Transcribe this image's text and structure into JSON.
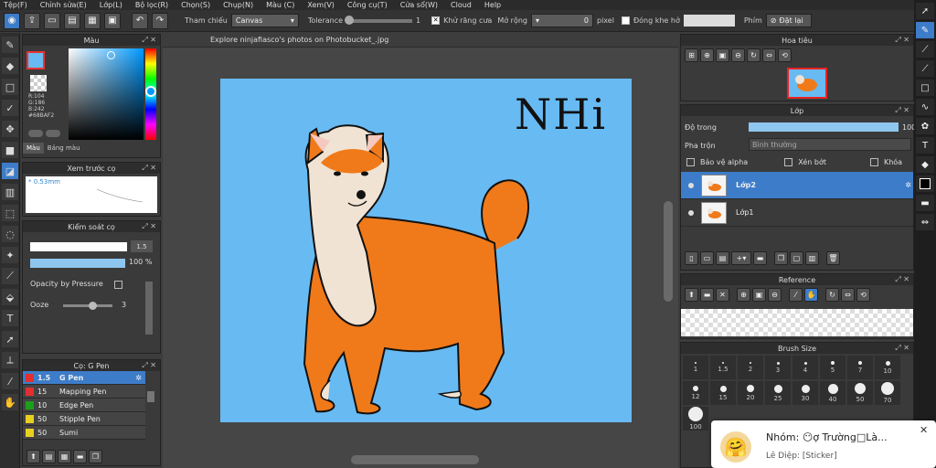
{
  "menu": [
    "Tệp(F)",
    "Chỉnh sửa(E)",
    "Lớp(L)",
    "Bộ lọc(R)",
    "Chọn(S)",
    "Chụp(N)",
    "Màu (C)",
    "Xem(V)",
    "Công cụ(T)",
    "Cửa sổ(W)",
    "Cloud",
    "Help"
  ],
  "toolbar": {
    "reference_label": "Tham chiếu",
    "reference_value": "Canvas",
    "tolerance_label": "Tolerance",
    "tolerance_value": "1",
    "antialias_label": "Khử răng cưa",
    "expand_label": "Mở rộng",
    "expand_value": "0",
    "expand_unit": "pixel",
    "close_gap_label": "Đóng khe hở",
    "shortcut_label": "Phím",
    "reset_label": "Đặt lại"
  },
  "color_panel": {
    "title": "Màu",
    "r": "R:104",
    "g": "G:186",
    "b": "B:242",
    "hex": "#68BAF2",
    "tab_color": "Màu",
    "tab_palette": "Bảng màu",
    "fg": "#68baf2"
  },
  "brush_preview": {
    "title": "Xem trước cọ",
    "size": "0.53mm"
  },
  "brush_control": {
    "title": "Kiểm soát cọ",
    "size_value": "1.5",
    "opacity_value": "100 %",
    "opacity_pressure_label": "Opacity by Pressure",
    "ooze_label": "Ooze",
    "ooze_value": "3"
  },
  "brush_list": {
    "title": "Cọ: G Pen",
    "items": [
      {
        "size": "1.5",
        "name": "G Pen",
        "color": "#e03030"
      },
      {
        "size": "15",
        "name": "Mapping Pen",
        "color": "#e03030"
      },
      {
        "size": "10",
        "name": "Edge Pen",
        "color": "#1aa01a"
      },
      {
        "size": "50",
        "name": "Stipple Pen",
        "color": "#e8d020"
      },
      {
        "size": "50",
        "name": "Sumi",
        "color": "#e8d020"
      }
    ]
  },
  "canvas": {
    "tab_title": "Explore ninjafiasco's photos on Photobucket_.jpg",
    "bg": "#68baf2",
    "handwriting": "NHi"
  },
  "navigator": {
    "title": "Hoa tiêu"
  },
  "layer_panel": {
    "title": "Lớp",
    "opacity_label": "Độ trong",
    "opacity_value": "100",
    "blend_label": "Pha trộn",
    "blend_value": "Bình thường",
    "protect_alpha_label": "Bảo vệ alpha",
    "clip_label": "Xén bớt",
    "lock_label": "Khóa",
    "layers": [
      {
        "name": "Lớp2",
        "selected": true
      },
      {
        "name": "Lớp1",
        "selected": false
      }
    ]
  },
  "reference_panel": {
    "title": "Reference"
  },
  "brush_size_panel": {
    "title": "Brush Size",
    "row1": [
      "1",
      "1.5",
      "2",
      "3",
      "4",
      "5",
      "7",
      "10"
    ],
    "row2": [
      "12",
      "15",
      "20",
      "25",
      "30",
      "40",
      "50",
      "70"
    ],
    "row3": [
      "100"
    ]
  },
  "notification": {
    "title": "Nhóm: 😶ợ Trường□Là...",
    "body": "Lê Diệp: [Sticker]",
    "emoji": "🤗",
    "close": "✕"
  }
}
